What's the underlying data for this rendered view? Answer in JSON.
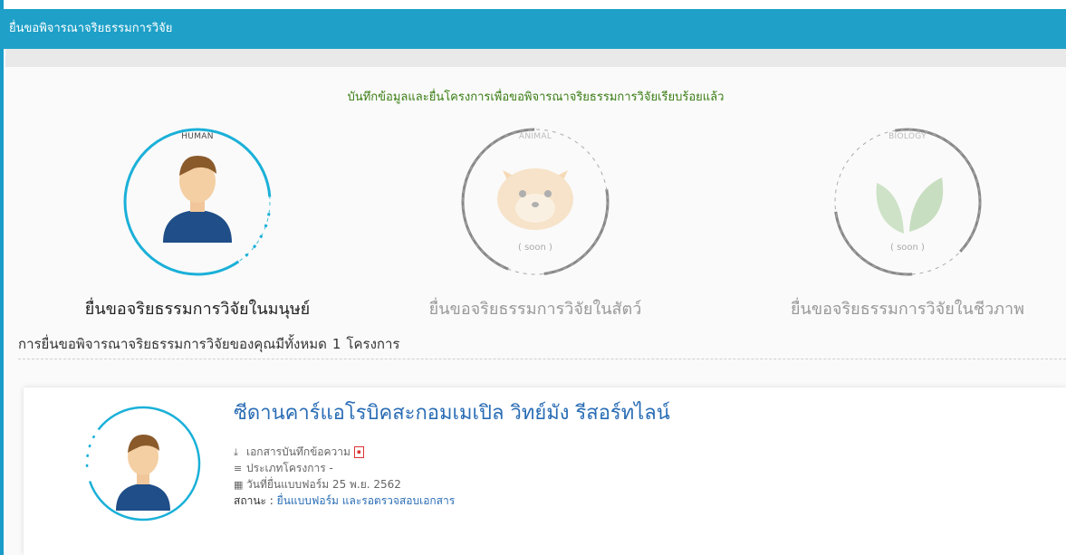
{
  "header": {
    "title": "ยื่นขอพิจารณาจริยธรรมการวิจัย"
  },
  "notice": {
    "success_message": "บันทึกข้อมูลและยื่นโครงการเพื่อขอพิจารณาจริยธรรมการวิจัยเรียบร้อยแล้ว"
  },
  "options": [
    {
      "category": "HUMAN",
      "label": "ยื่นขอจริยธรรมการวิจัยในมนุษย์",
      "soon": "",
      "icon": "person-icon",
      "enabled": true
    },
    {
      "category": "ANIMAL",
      "label": "ยื่นขอจริยธรรมการวิจัยในสัตว์",
      "soon": "( soon )",
      "icon": "cat-icon",
      "enabled": false
    },
    {
      "category": "BIOLOGY",
      "label": "ยื่นขอจริยธรรมการวิจัยในชีวภาพ",
      "soon": "( soon )",
      "icon": "leaf-icon",
      "enabled": false
    }
  ],
  "summary": {
    "prefix": "การยื่นขอพิจารณาจริยธรรมการวิจัยของคุณมีทั้งหมด",
    "count": "1",
    "suffix": "โครงการ"
  },
  "project": {
    "title": "ซีดานคาร์แอโรบิคสะกอมเมเปิล วิทย์มัง รีสอร์ทไลน์",
    "document_label": "เอกสารบันทึกข้อความ",
    "project_type": "ประเภทโครงการ -",
    "submitted_date": "วันที่ยื่นแบบฟอร์ม 25 พ.ย. 2562",
    "status_label": "สถานะ :",
    "status_value": "ยื่นแบบฟอร์ม และรอตรวจสอบเอกสาร"
  },
  "colors": {
    "header": "#1ea0c8",
    "accent": "#1ab0d8",
    "success": "#3a7d13",
    "link": "#2a6db5"
  }
}
